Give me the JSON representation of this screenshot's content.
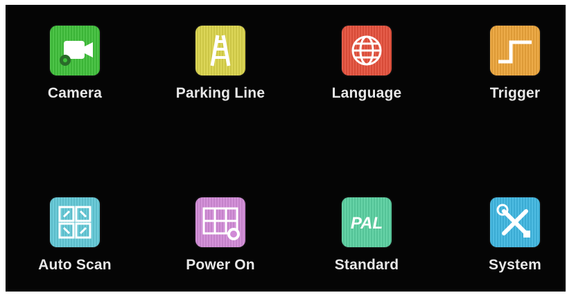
{
  "menu": {
    "items": [
      {
        "label": "Camera",
        "icon": "camera-icon",
        "color": "#3fbf3a"
      },
      {
        "label": "Parking Line",
        "icon": "parking-line-icon",
        "color": "#d9d24a"
      },
      {
        "label": "Language",
        "icon": "language-globe-icon",
        "color": "#e4503c"
      },
      {
        "label": "Trigger",
        "icon": "trigger-icon",
        "color": "#eba43a"
      },
      {
        "label": "Auto Scan",
        "icon": "auto-scan-icon",
        "color": "#62c8d6"
      },
      {
        "label": "Power On",
        "icon": "power-on-icon",
        "color": "#d08ad6"
      },
      {
        "label": "Standard",
        "icon": "standard-pal-icon",
        "color": "#59cfa0",
        "icon_text": "PAL"
      },
      {
        "label": "System",
        "icon": "system-tools-icon",
        "color": "#3fb6e0"
      }
    ]
  }
}
